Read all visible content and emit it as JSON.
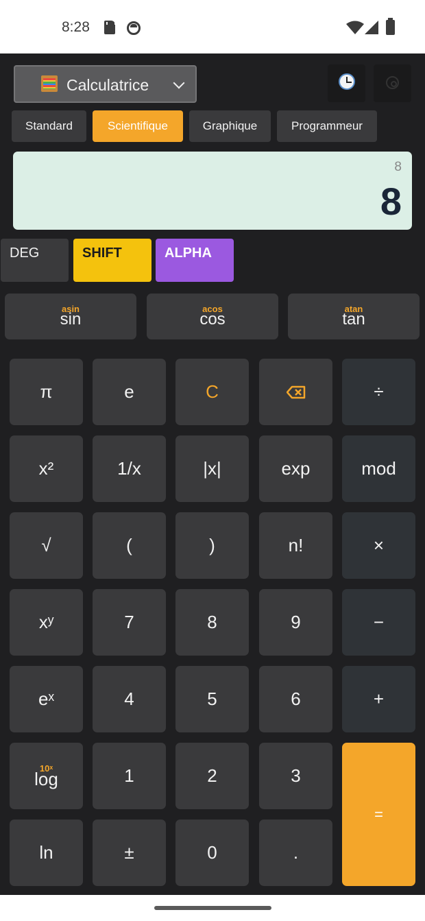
{
  "status_bar": {
    "time": "8:28",
    "icons": [
      "sd-card-icon",
      "face-icon",
      "wifi-icon",
      "signal-icon",
      "battery-icon"
    ]
  },
  "header": {
    "mode_label": "Calculatrice",
    "mode_icon": "abacus-icon",
    "history_icon": "clock-icon",
    "settings_icon": "gear-icon"
  },
  "tabs": [
    {
      "label": "Standard",
      "active": false
    },
    {
      "label": "Scientifique",
      "active": true
    },
    {
      "label": "Graphique",
      "active": false
    },
    {
      "label": "Programmeur",
      "active": false
    }
  ],
  "display": {
    "expression": "8",
    "result": "8"
  },
  "toggles": {
    "deg": "DEG",
    "shift": "SHIFT",
    "alpha": "ALPHA"
  },
  "trig": [
    {
      "main": "sin",
      "shift": "asin"
    },
    {
      "main": "cos",
      "shift": "acos"
    },
    {
      "main": "tan",
      "shift": "atan"
    }
  ],
  "keys": {
    "pi": "π",
    "e": "e",
    "clear": "C",
    "divide": "÷",
    "square": "x²",
    "reciprocal": "1/x",
    "abs": "|x|",
    "exp": "exp",
    "mod": "mod",
    "sqrt": "√",
    "lparen": "(",
    "rparen": ")",
    "factorial": "n!",
    "multiply": "×",
    "power": "xʸ",
    "seven": "7",
    "eight": "8",
    "nine": "9",
    "minus": "−",
    "exp_e": "eˣ",
    "four": "4",
    "five": "5",
    "six": "6",
    "plus": "+",
    "log": "log",
    "log_shift": "10ˣ",
    "one": "1",
    "two": "2",
    "three": "3",
    "equals": "=",
    "ln": "ln",
    "plus_minus": "±",
    "zero": "0",
    "decimal": "."
  },
  "colors": {
    "accent": "#f4a62a",
    "shift": "#f4c20d",
    "alpha": "#9b59e0",
    "display_bg": "#dcefe6",
    "app_bg": "#1f1f21",
    "key_bg": "#3a3a3c"
  }
}
